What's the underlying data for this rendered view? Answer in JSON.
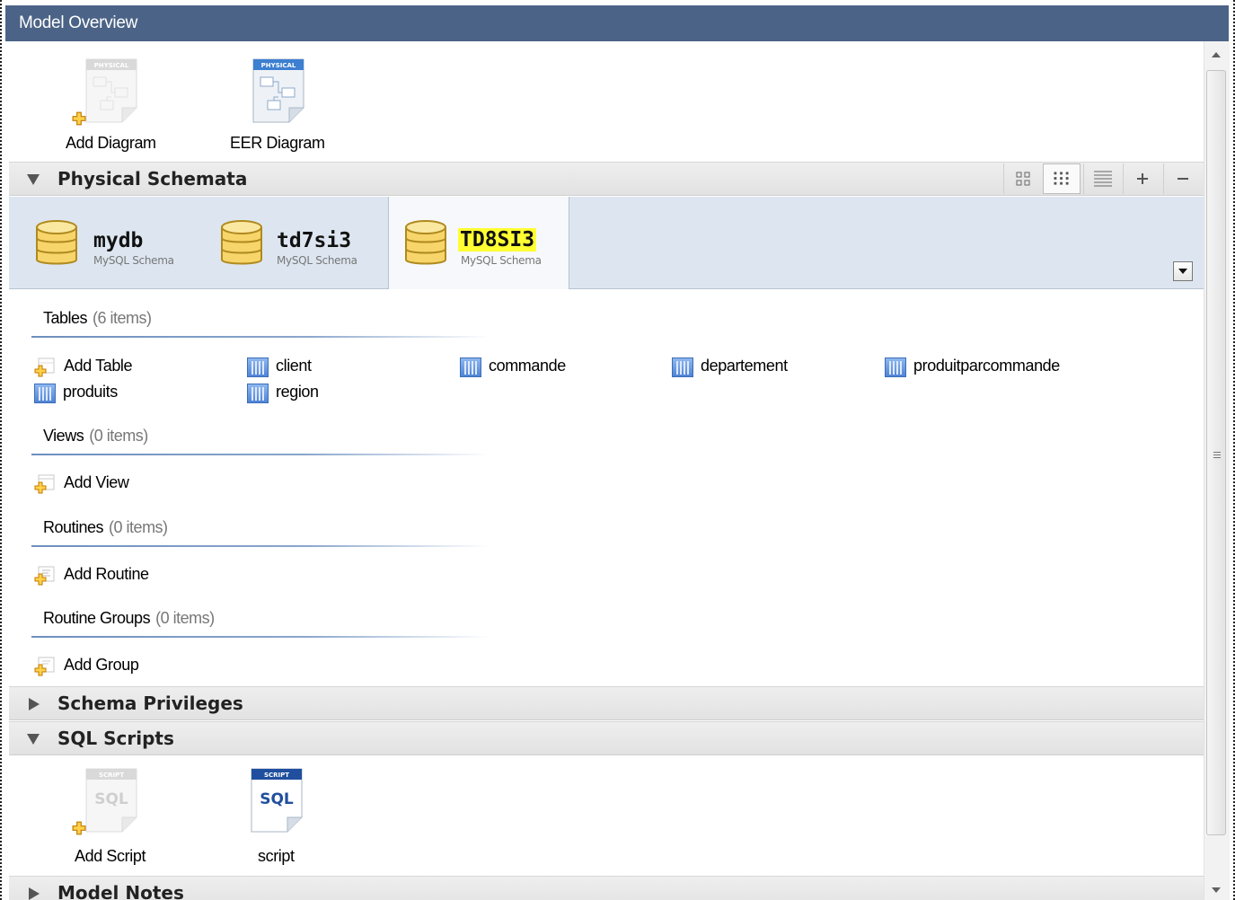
{
  "window": {
    "title": "Model Overview"
  },
  "diagrams": [
    {
      "label": "Add Diagram",
      "badge": "PHYSICAL",
      "kind": "add"
    },
    {
      "label": "EER Diagram",
      "badge": "PHYSICAL",
      "kind": "existing"
    }
  ],
  "physical_schemata": {
    "title": "Physical Schemata",
    "expanded": true,
    "toolbar": [
      "large-icons-view",
      "small-icons-view",
      "list-view",
      "add-schema",
      "remove-schema"
    ],
    "schemas": [
      {
        "name": "mydb",
        "type": "MySQL Schema",
        "selected": false
      },
      {
        "name": "td7si3",
        "type": "MySQL Schema",
        "selected": false
      },
      {
        "name": "TD8SI3",
        "type": "MySQL Schema",
        "selected": true
      }
    ],
    "groups": {
      "tables": {
        "title": "Tables",
        "count": "(6 items)",
        "add_label": "Add Table",
        "items": [
          "client",
          "commande",
          "departement",
          "produitparcommande",
          "produits",
          "region"
        ]
      },
      "views": {
        "title": "Views",
        "count": "(0 items)",
        "add_label": "Add View"
      },
      "routines": {
        "title": "Routines",
        "count": "(0 items)",
        "add_label": "Add Routine"
      },
      "routine_groups": {
        "title": "Routine Groups",
        "count": "(0 items)",
        "add_label": "Add Group"
      }
    }
  },
  "schema_privileges": {
    "title": "Schema Privileges",
    "expanded": false
  },
  "sql_scripts": {
    "title": "SQL Scripts",
    "expanded": true,
    "items": [
      {
        "label": "Add Script",
        "badge": "SCRIPT",
        "text": "SQL",
        "kind": "add"
      },
      {
        "label": "script",
        "badge": "SCRIPT",
        "text": "SQL",
        "kind": "existing"
      }
    ]
  },
  "model_notes": {
    "title": "Model Notes",
    "expanded": false
  },
  "colors": {
    "titlebar": "#4b6386",
    "schema_strip": "#dde6f0",
    "highlight": "#ffff33",
    "badge_active": "#3d7fd1",
    "script_badge_active": "#1f4f9e"
  }
}
